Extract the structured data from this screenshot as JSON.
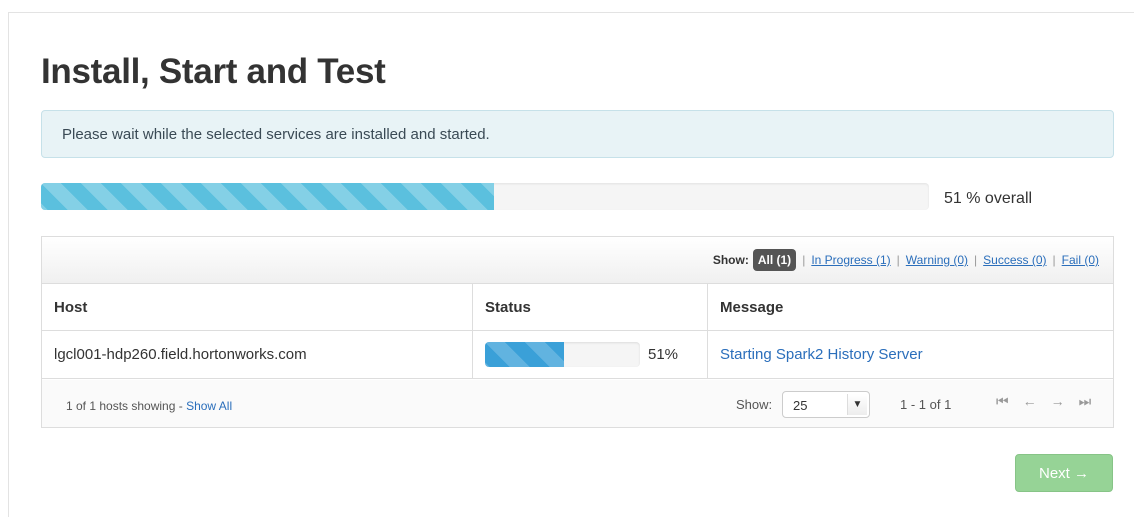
{
  "page": {
    "title": "Install, Start and Test",
    "alert_message": "Please wait while the selected services are installed and started."
  },
  "overall_progress": {
    "percent": 51,
    "label": "51 % overall"
  },
  "filters": {
    "show_label": "Show:",
    "all": "All (1)",
    "in_progress": "In Progress (1)",
    "warning": "Warning (0)",
    "success": "Success (0)",
    "fail": "Fail (0)",
    "separator": "|"
  },
  "table": {
    "columns": [
      "Host",
      "Status",
      "Message"
    ],
    "rows": [
      {
        "host": "lgcl001-hdp260.field.hortonworks.com",
        "status_percent": 51,
        "status_label": "51%",
        "message": "Starting Spark2 History Server"
      }
    ]
  },
  "footer": {
    "hosts_showing": "1 of 1 hosts showing - ",
    "show_all": "Show All",
    "show_label": "Show:",
    "page_size": "25",
    "range": "1 - 1 of 1"
  },
  "icons": {
    "first": "first-page-icon",
    "prev": "prev-page-icon",
    "next": "next-page-icon",
    "last": "last-page-icon",
    "caret": "chevron-down-icon"
  },
  "colors": {
    "progress_overall": "#5bc0de",
    "progress_host": "#3aa0d8",
    "next_button": "#96d396",
    "link": "#2a6ebb"
  },
  "actions": {
    "next_label": "Next →"
  }
}
